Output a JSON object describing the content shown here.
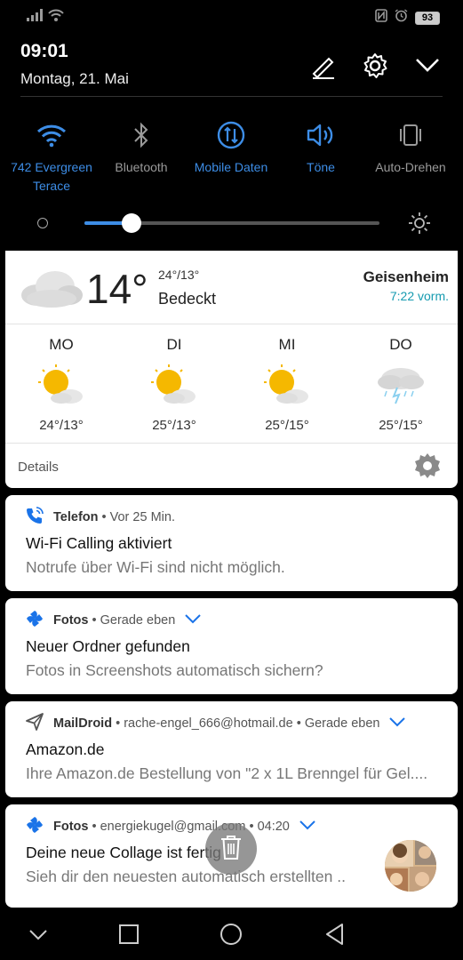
{
  "statusbar": {
    "battery": "93"
  },
  "header": {
    "time": "09:01",
    "date": "Montag, 21. Mai"
  },
  "toggles": [
    {
      "label": "742 Evergreen Terace",
      "state": "on",
      "icon": "wifi-icon"
    },
    {
      "label": "Bluetooth",
      "state": "off",
      "icon": "bluetooth-icon"
    },
    {
      "label": "Mobile Daten",
      "state": "on",
      "icon": "mobile-data-icon"
    },
    {
      "label": "Töne",
      "state": "on",
      "icon": "sound-icon"
    },
    {
      "label": "Auto-Drehen",
      "state": "off",
      "icon": "auto-rotate-icon"
    }
  ],
  "brightness": {
    "level": 0.16
  },
  "weather": {
    "temp": "14°",
    "range": "24°/13°",
    "condition": "Bedeckt",
    "city": "Geisenheim",
    "updated": "7:22 vorm.",
    "forecast": [
      {
        "day": "MO",
        "temps": "24°/13°",
        "icon": "sun-cloud-icon"
      },
      {
        "day": "DI",
        "temps": "25°/13°",
        "icon": "sun-cloud-icon"
      },
      {
        "day": "MI",
        "temps": "25°/15°",
        "icon": "sun-cloud-icon"
      },
      {
        "day": "DO",
        "temps": "25°/15°",
        "icon": "thunderstorm-icon"
      }
    ],
    "details_label": "Details"
  },
  "notifications": [
    {
      "app": "Telefon",
      "meta": "Vor 25 Min.",
      "title": "Wi-Fi Calling aktiviert",
      "body": "Notrufe über Wi-Fi sind nicht möglich.",
      "icon": "phone-wifi-icon"
    },
    {
      "app": "Fotos",
      "meta": "Gerade eben",
      "title": "Neuer Ordner gefunden",
      "body": "Fotos in Screenshots automatisch sichern?",
      "icon": "google-photos-icon"
    },
    {
      "app": "MailDroid",
      "account": "rache-engel_666@hotmail.de",
      "meta": "Gerade eben",
      "title": "Amazon.de",
      "body": "Ihre Amazon.de Bestellung von \"2 x 1L Brenngel für Gel....",
      "icon": "send-icon"
    },
    {
      "app": "Fotos",
      "account": "energiekugel@gmail.com",
      "meta": "04:20",
      "title": "Deine neue Collage ist fertig",
      "body": "Sieh dir den neuesten automatisch erstellten ..",
      "icon": "google-photos-icon"
    }
  ],
  "colors": {
    "accent": "#3d8de6",
    "weather_time": "#169bb0"
  }
}
